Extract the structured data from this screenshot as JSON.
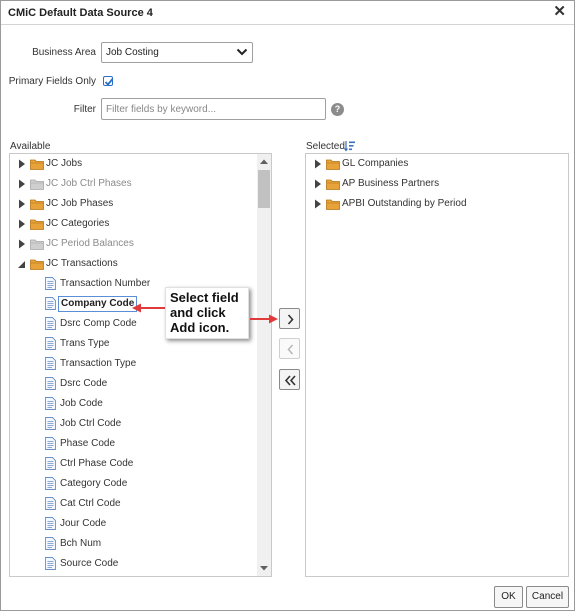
{
  "dialog": {
    "title": "CMiC Default Data Source 4",
    "close_glyph": "✕"
  },
  "form": {
    "business_area_label": "Business Area",
    "business_area_value": "Job Costing",
    "primary_fields_label": "Primary Fields Only",
    "primary_fields_checked": true,
    "filter_label": "Filter",
    "filter_value": "",
    "filter_placeholder": "Filter fields by keyword...",
    "help_glyph": "?"
  },
  "available": {
    "label": "Available",
    "items": [
      {
        "label": "JC Jobs",
        "type": "folder",
        "level": 0,
        "state": "collapsed",
        "disabled": false
      },
      {
        "label": "JC Job Ctrl Phases",
        "type": "folder",
        "level": 0,
        "state": "collapsed",
        "disabled": true
      },
      {
        "label": "JC Job Phases",
        "type": "folder",
        "level": 0,
        "state": "collapsed",
        "disabled": false
      },
      {
        "label": "JC Categories",
        "type": "folder",
        "level": 0,
        "state": "collapsed",
        "disabled": false
      },
      {
        "label": "JC Period Balances",
        "type": "folder",
        "level": 0,
        "state": "collapsed",
        "disabled": true
      },
      {
        "label": "JC Transactions",
        "type": "folder",
        "level": 0,
        "state": "expanded",
        "disabled": false
      },
      {
        "label": "Transaction Number",
        "type": "field",
        "level": 1
      },
      {
        "label": "Company Code",
        "type": "field",
        "level": 1,
        "selected": true
      },
      {
        "label": "Dsrc Comp Code",
        "type": "field",
        "level": 1
      },
      {
        "label": "Trans Type",
        "type": "field",
        "level": 1
      },
      {
        "label": "Transaction Type",
        "type": "field",
        "level": 1
      },
      {
        "label": "Dsrc Code",
        "type": "field",
        "level": 1
      },
      {
        "label": "Job Code",
        "type": "field",
        "level": 1
      },
      {
        "label": "Job Ctrl Code",
        "type": "field",
        "level": 1
      },
      {
        "label": "Phase Code",
        "type": "field",
        "level": 1
      },
      {
        "label": "Ctrl Phase Code",
        "type": "field",
        "level": 1
      },
      {
        "label": "Category Code",
        "type": "field",
        "level": 1
      },
      {
        "label": "Cat Ctrl Code",
        "type": "field",
        "level": 1
      },
      {
        "label": "Jour Code",
        "type": "field",
        "level": 1
      },
      {
        "label": "Bch Num",
        "type": "field",
        "level": 1
      },
      {
        "label": "Source Code",
        "type": "field",
        "level": 1
      }
    ]
  },
  "selected": {
    "label": "Selected",
    "sort_icon": "sort-tree-icon",
    "items": [
      {
        "label": "GL Companies",
        "type": "folder",
        "state": "collapsed"
      },
      {
        "label": "AP Business Partners",
        "type": "folder",
        "state": "collapsed"
      },
      {
        "label": "APBI Outstanding by Period",
        "type": "folder",
        "state": "collapsed"
      }
    ]
  },
  "move_buttons": {
    "add_icon": "chevron-right-icon",
    "remove_icon": "chevron-left-icon",
    "remove_all_icon": "double-chevron-left-icon"
  },
  "callout": {
    "lines": [
      "Select field",
      "and click",
      "Add icon."
    ]
  },
  "footer": {
    "ok_label": "OK",
    "cancel_label": "Cancel"
  },
  "colors": {
    "folder": "#e8a23a",
    "arrow_annotation": "#e03a3a",
    "selection_border": "#5b8ed6",
    "doc_icon": "#6a8fc5"
  }
}
